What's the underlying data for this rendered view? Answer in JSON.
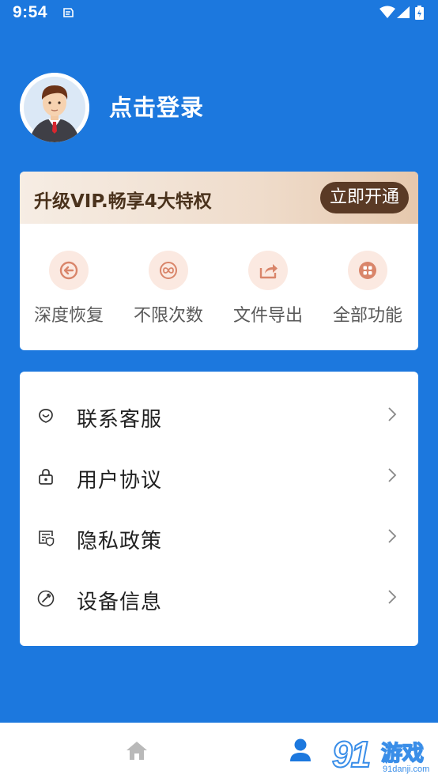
{
  "status_bar": {
    "time": "9:54"
  },
  "profile": {
    "login_text": "点击登录"
  },
  "vip": {
    "title": "升级VIP.畅享4大特权",
    "open_button": "立即开通",
    "features": [
      {
        "label": "深度恢复",
        "icon": "restore-icon"
      },
      {
        "label": "不限次数",
        "icon": "infinity-icon"
      },
      {
        "label": "文件导出",
        "icon": "export-icon"
      },
      {
        "label": "全部功能",
        "icon": "grid-icon"
      }
    ]
  },
  "menu": {
    "items": [
      {
        "label": "联系客服",
        "icon": "smile-icon"
      },
      {
        "label": "用户协议",
        "icon": "lock-icon"
      },
      {
        "label": "隐私政策",
        "icon": "shield-document-icon"
      },
      {
        "label": "设备信息",
        "icon": "wrench-icon"
      }
    ]
  },
  "bottom_nav": {
    "items": [
      {
        "name": "home",
        "icon": "home-icon",
        "active": false
      },
      {
        "name": "profile",
        "icon": "person-icon",
        "active": true
      }
    ]
  },
  "watermark": {
    "number": "91",
    "text": "游戏",
    "url": "91danji.com"
  },
  "colors": {
    "background": "#1c78de",
    "vip_button": "#5a3a25",
    "vip_text": "#4a321c",
    "feature_icon_bg": "#fbe9e1",
    "feature_icon_fg": "#d9856a",
    "nav_active": "#1c78de",
    "nav_inactive": "#b9b9b9"
  }
}
